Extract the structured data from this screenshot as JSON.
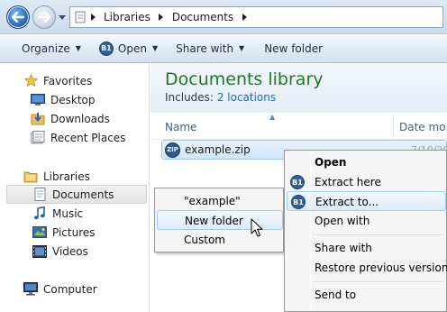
{
  "address": {
    "crumbs": [
      "Libraries",
      "Documents"
    ]
  },
  "toolbar": {
    "organize": "Organize",
    "open": "Open",
    "open_badge": "B1",
    "share_with": "Share with",
    "new_folder": "New folder"
  },
  "nav": {
    "favorites_header": "Favorites",
    "favorites": [
      "Desktop",
      "Downloads",
      "Recent Places"
    ],
    "libraries_header": "Libraries",
    "libraries": [
      "Documents",
      "Music",
      "Pictures",
      "Videos"
    ],
    "computer": "Computer",
    "selected": "Documents"
  },
  "library": {
    "title": "Documents library",
    "includes_label": "Includes:",
    "includes_link": "2 locations"
  },
  "columns": {
    "name": "Name",
    "date_modified": "Date mo"
  },
  "file": {
    "icon_text": "ZIP",
    "name": "example.zip",
    "date": "7/10/201"
  },
  "context_menu": {
    "items": [
      "Open",
      "Extract here",
      "Extract to...",
      "Open with",
      "Share with",
      "Restore previous versions",
      "Send to"
    ],
    "badge": "B1",
    "highlighted": "Extract to..."
  },
  "submenu": {
    "items": [
      "\"example\"",
      "New folder",
      "Custom"
    ],
    "highlighted": "New folder"
  },
  "colors": {
    "library_title": "#1f7a22",
    "link": "#1a6ec0",
    "selection_border": "#9cc6ef"
  }
}
